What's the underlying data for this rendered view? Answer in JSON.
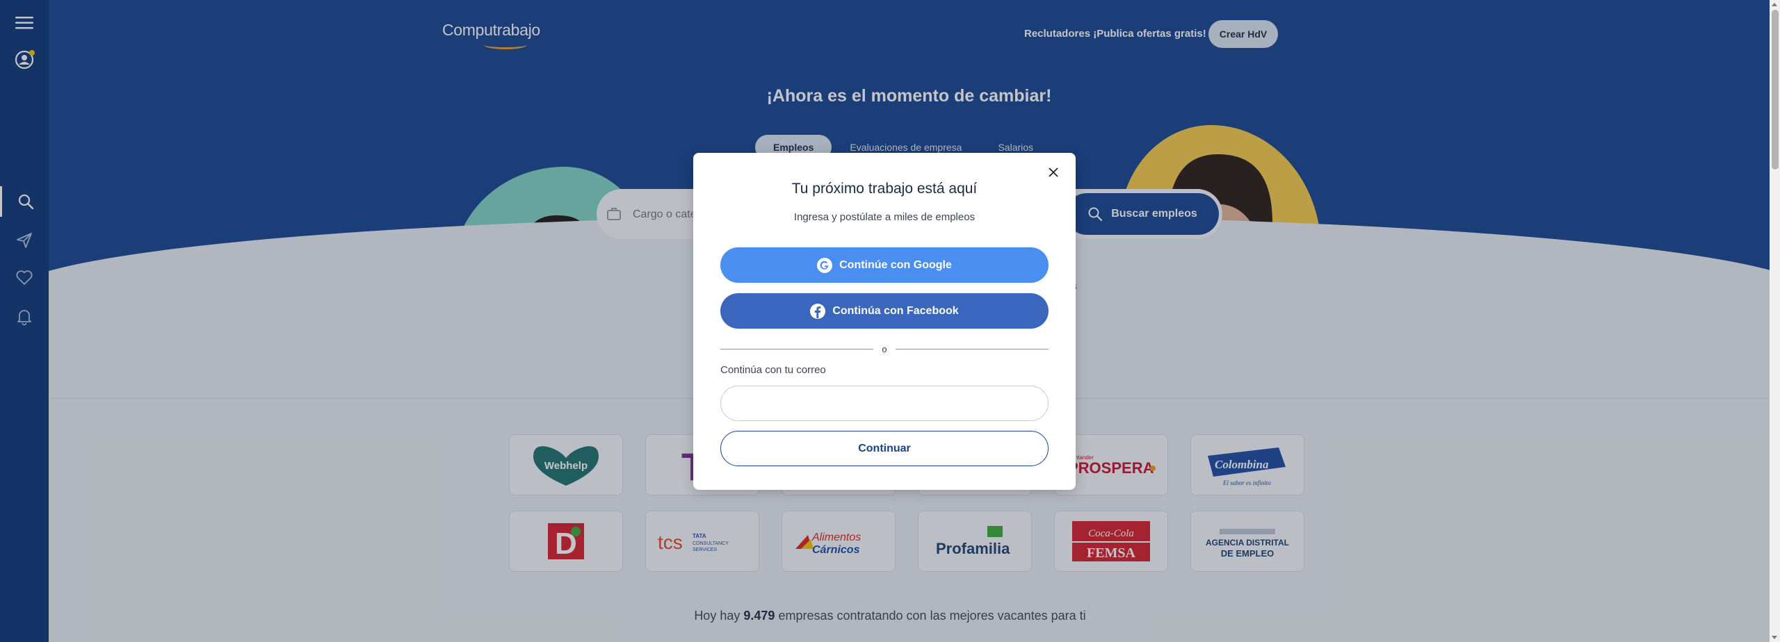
{
  "header": {
    "logo": "Computrabajo",
    "recruiters_link": "Reclutadores ¡Publica ofertas gratis!",
    "create_cv_button": "Crear HdV"
  },
  "hero": {
    "title": "¡Ahora es el momento de cambiar!",
    "tabs": [
      {
        "label": "Empleos",
        "active": true
      },
      {
        "label": "Evaluaciones de empresa",
        "active": false
      },
      {
        "label": "Salarios",
        "active": false
      }
    ],
    "search_placeholder": "Cargo o categoría",
    "search_button": "Buscar empleos",
    "partial_text": "as"
  },
  "sidebar": {
    "items": [
      {
        "icon": "menu-icon"
      },
      {
        "icon": "user-icon",
        "has_notification": true
      },
      {
        "icon": "search-icon",
        "active": true
      },
      {
        "icon": "send-icon"
      },
      {
        "icon": "heart-icon"
      },
      {
        "icon": "bell-icon"
      }
    ]
  },
  "companies": {
    "logos": [
      "Webhelp",
      "T",
      "",
      "",
      "PROSPERA",
      "Colombina",
      "D",
      "tcs TATA CONSULTANCY SERVICES",
      "Alimentos Cárnicos",
      "Profamilia",
      "Coca-Cola FEMSA",
      "AGENCIA DISTRITAL DE EMPLEO"
    ],
    "summary_prefix": "Hoy hay",
    "summary_count": "9.479",
    "summary_suffix": "empresas contratando con las mejores vacantes para ti"
  },
  "modal": {
    "title": "Tu próximo trabajo está aquí",
    "subtitle": "Ingresa y postúlate a miles de empleos",
    "google_button": "Continúe con Google",
    "facebook_button": "Continúa con Facebook",
    "or": "o",
    "email_label": "Continúa con tu correo",
    "email_value": "",
    "continue_button": "Continuar"
  },
  "colors": {
    "brand_navy": "#17438f",
    "sidebar": "#0d3578",
    "google_blue": "#4a8ef0",
    "facebook_blue": "#3a67bd",
    "accent_orange": "#f29b22",
    "notification_yellow": "#f5c400"
  }
}
